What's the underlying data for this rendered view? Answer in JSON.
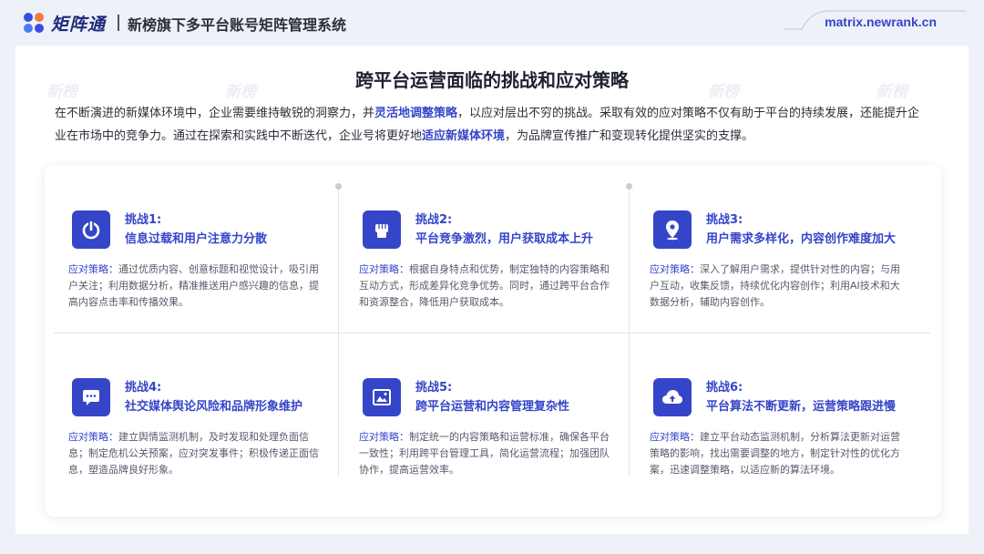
{
  "header": {
    "logo_text": "矩阵通",
    "title": "新榜旗下多平台账号矩阵管理系统",
    "url": "matrix.newrank.cn"
  },
  "main": {
    "title": "跨平台运营面临的挑战和应对策略",
    "intro": {
      "part1": "在不断演进的新媒体环境中，企业需要维持敏锐的洞察力，并",
      "hl1": "灵活地调整策略",
      "part2": "，以应对层出不穷的挑战。采取有效的应对策略不仅有助于平台的持续发展，还能提升企业在市场中的竞争力。通过在探索和实践中不断迭代，企业号将更好地",
      "hl2": "适应新媒体环境",
      "part3": "，为品牌宣传推广和变现转化提供坚实的支撑。"
    },
    "watermark_text": "新榜"
  },
  "challenges": [
    {
      "label": "挑战1:",
      "title": "信息过载和用户注意力分散",
      "lead": "应对策略：",
      "text": "通过优质内容、创意标题和视觉设计，吸引用户关注；利用数据分析，精准推送用户感兴趣的信息，提高内容点击率和传播效果。",
      "icon": "power-icon"
    },
    {
      "label": "挑战2:",
      "title": "平台竞争激烈，用户获取成本上升",
      "lead": "应对策略：",
      "text": "根据自身特点和优势，制定独特的内容策略和互动方式，形成差异化竞争优势。同时，通过跨平台合作和资源整合，降低用户获取成本。",
      "icon": "fist-icon"
    },
    {
      "label": "挑战3:",
      "title": "用户需求多样化，内容创作难度加大",
      "lead": "应对策略：",
      "text": "深入了解用户需求，提供针对性的内容；与用户互动，收集反馈，持续优化内容创作；利用AI技术和大数据分析，辅助内容创作。",
      "icon": "location-pin-icon"
    },
    {
      "label": "挑战4:",
      "title": "社交媒体舆论风险和品牌形象维护",
      "lead": "应对策略：",
      "text": "建立舆情监测机制，及时发现和处理负面信息；制定危机公关预案，应对突发事件；积极传递正面信息，塑造品牌良好形象。",
      "icon": "chat-bubble-icon"
    },
    {
      "label": "挑战5:",
      "title": "跨平台运营和内容管理复杂性",
      "lead": "应对策略：",
      "text": "制定统一的内容策略和运营标准，确保各平台一致性；利用跨平台管理工具，简化运营流程；加强团队协作，提高运营效率。",
      "icon": "image-frame-icon"
    },
    {
      "label": "挑战6:",
      "title": "平台算法不断更新，运营策略跟进慢",
      "lead": "应对策略：",
      "text": "建立平台动态监测机制，分析算法更新对运营策略的影响，找出需要调整的地方，制定针对性的优化方案，迅速调整策略，以适应新的算法环境。",
      "icon": "cloud-upload-icon"
    }
  ],
  "colors": {
    "accent": "#3545c8",
    "background": "#eef1f8"
  }
}
